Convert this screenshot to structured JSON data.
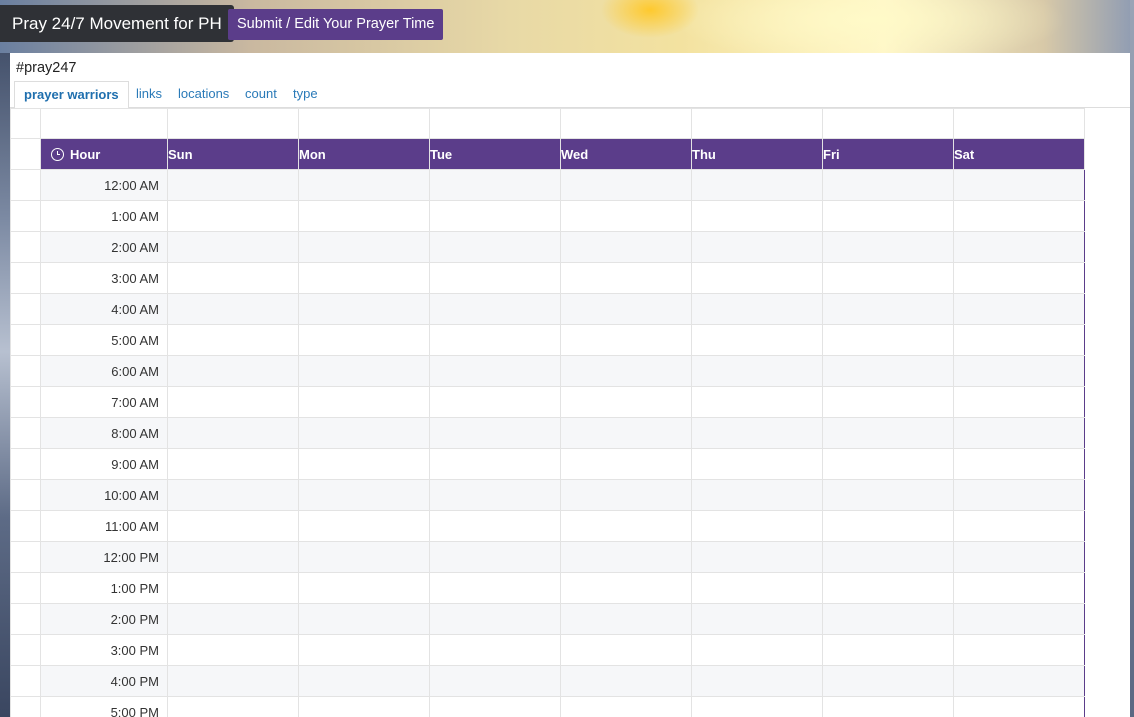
{
  "navbar": {
    "brand": "Pray 24/7 Movement for PH",
    "submit_label": "Submit / Edit Your Prayer Time"
  },
  "hashtag": "#pray247",
  "tabs": [
    "prayer warriors",
    "links",
    "locations",
    "count",
    "type"
  ],
  "active_tab": "prayer warriors",
  "schedule": {
    "hour_header": "Hour",
    "hour_icon": "clock-icon",
    "days": [
      "Sun",
      "Mon",
      "Tue",
      "Wed",
      "Thu",
      "Fri",
      "Sat"
    ],
    "hours": [
      "12:00 AM",
      "1:00 AM",
      "2:00 AM",
      "3:00 AM",
      "4:00 AM",
      "5:00 AM",
      "6:00 AM",
      "7:00 AM",
      "8:00 AM",
      "9:00 AM",
      "10:00 AM",
      "11:00 AM",
      "12:00 PM",
      "1:00 PM",
      "2:00 PM",
      "3:00 PM",
      "4:00 PM",
      "5:00 PM"
    ]
  },
  "colors": {
    "header_purple": "#5b3d8a",
    "link_blue": "#2a7ab8",
    "brand_dark": "#2f3136"
  }
}
